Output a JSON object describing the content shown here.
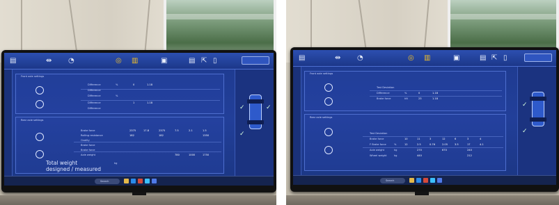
{
  "photos": [
    {
      "id_label": "left",
      "app": {
        "section1_title": "Front axle settings",
        "section2_title": "Rear axle settings",
        "rows_top": [
          "Difference",
          "Difference",
          "Difference",
          "Difference",
          "Difference"
        ],
        "rows_bottom": [
          "Brake force",
          "Rolling resistance",
          "Ovality",
          "Brake force",
          "Brake force",
          "Axle weight"
        ],
        "unit_percent": "%",
        "unit_kn": "kN",
        "unit_kg": "kg",
        "vals_top": [
          "0",
          "1.18",
          "1",
          "1.18"
        ],
        "vals_bottom": [
          "2375",
          "17.8",
          "2375",
          "7.5",
          "182",
          "182",
          "2.1",
          "1000",
          "1.5",
          "1350",
          "1750",
          "780"
        ],
        "total_weight_label": "Total weight designed / measured",
        "total_weight_unit": "kg",
        "taskbar_search": "Search"
      }
    },
    {
      "id_label": "right",
      "app": {
        "section1_title": "Front axle settings",
        "section2_title": "Rear axle settings",
        "rows_top": [
          "Test Deviation",
          "Difference",
          "Brake force"
        ],
        "rows_bottom": [
          "Test Deviation",
          "Brake force",
          "F Brake force",
          "Axle weight",
          "Wheel weight"
        ],
        "unit_percent": "%",
        "unit_kn": "kN",
        "unit_kg": "kg",
        "vals_top": [
          "0",
          "1.18",
          "23",
          "1.18"
        ],
        "vals_bottom": [
          "10",
          "11",
          "3",
          "12",
          "6",
          "3",
          "4",
          "12",
          "2.5",
          "0.76",
          "2.05",
          "3.5",
          "17",
          "4.1",
          "270",
          "670",
          "240",
          "440",
          "212"
        ],
        "taskbar_search": "Search"
      }
    }
  ]
}
